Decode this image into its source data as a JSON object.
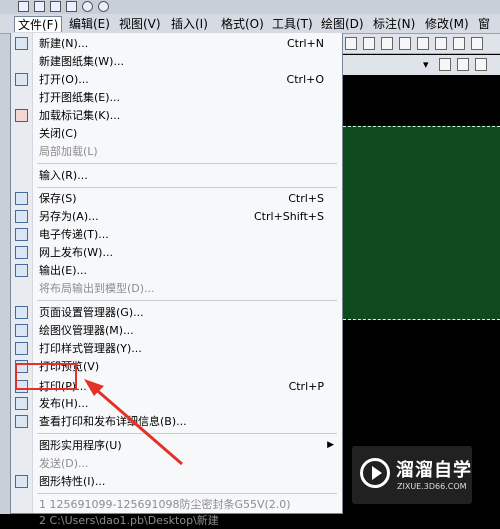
{
  "menubar": [
    "文件(F)",
    "编辑(E)",
    "视图(V)",
    "插入(I)",
    "格式(O)",
    "工具(T)",
    "绘图(D)",
    "标注(N)",
    "修改(M)",
    "窗口"
  ],
  "file_menu": {
    "items": [
      {
        "label": "新建(N)...",
        "shortcut": "Ctrl+N",
        "icon": "new-file-icon"
      },
      {
        "label": "新建图纸集(W)...",
        "icon": ""
      },
      {
        "label": "打开(O)...",
        "shortcut": "Ctrl+O",
        "icon": "open-folder-icon"
      },
      {
        "label": "打开图纸集(E)...",
        "icon": ""
      },
      {
        "label": "加载标记集(K)...",
        "icon": "markup-icon"
      },
      {
        "label": "关闭(C)",
        "icon": ""
      },
      {
        "label": "局部加载(L)",
        "disabled": true,
        "icon": ""
      },
      {
        "label": "输入(R)...",
        "icon": ""
      },
      {
        "label": "保存(S)",
        "shortcut": "Ctrl+S",
        "icon": "save-icon"
      },
      {
        "label": "另存为(A)...",
        "shortcut": "Ctrl+Shift+S",
        "icon": "save-as-icon"
      },
      {
        "label": "电子传递(T)...",
        "icon": "etransmit-icon"
      },
      {
        "label": "网上发布(W)...",
        "icon": "web-publish-icon"
      },
      {
        "label": "输出(E)...",
        "icon": "export-icon"
      },
      {
        "label": "将布局输出到模型(D)...",
        "disabled": true,
        "icon": ""
      },
      {
        "label": "页面设置管理器(G)...",
        "icon": "page-setup-icon"
      },
      {
        "label": "绘图仪管理器(M)...",
        "icon": "plotter-icon"
      },
      {
        "label": "打印样式管理器(Y)...",
        "icon": "plot-style-icon"
      },
      {
        "label": "打印预览(V)",
        "icon": "print-preview-icon"
      },
      {
        "label": "打印(P)...",
        "shortcut": "Ctrl+P",
        "icon": "print-icon"
      },
      {
        "label": "发布(H)...",
        "icon": "publish-icon"
      },
      {
        "label": "查看打印和发布详细信息(B)...",
        "icon": "plot-details-icon"
      },
      {
        "label": "图形实用程序(U)",
        "submenu": true,
        "icon": ""
      },
      {
        "label": "发送(D)...",
        "disabled": true,
        "icon": ""
      },
      {
        "label": "图形特性(I)...",
        "icon": "drawing-properties-icon"
      },
      {
        "label": "1 125691099-125691098防尘密封条G55V(2.0)",
        "disabled": true,
        "icon": ""
      },
      {
        "label": "2 C:\\Users\\dao1.pb\\Desktop\\新建",
        "disabled": true,
        "icon": ""
      }
    ]
  },
  "watermark": {
    "title": "溜溜自学",
    "url": "ZIXUE.3D66.COM"
  },
  "colors": {
    "highlight": "#e53228",
    "canvas": "#000000",
    "viewport": "#0e4a1e"
  }
}
